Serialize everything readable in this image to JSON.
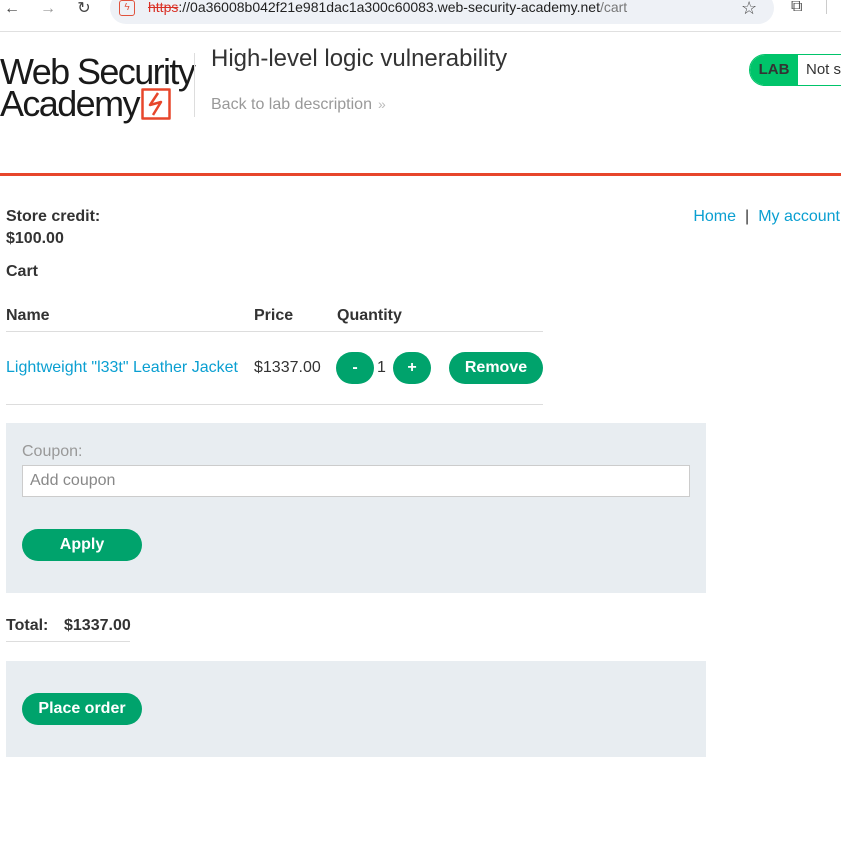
{
  "browser": {
    "url_scheme": "https",
    "url_sep": "://",
    "url_host": "0a36008b042f21e981dac1a300c60083.web-security-academy.net",
    "url_path": "/cart",
    "back_icon": "←",
    "forward_icon": "→",
    "reload_icon": "↻",
    "star_icon": "☆",
    "extensions_icon": "⧉",
    "site_icon": "ϟ"
  },
  "header": {
    "logo_line1": "Web Security",
    "logo_line2": "Academy",
    "lab_title": "High-level logic vulnerability",
    "back_link": "Back to lab description",
    "back_chevron": "»",
    "lab_badge": "LAB",
    "lab_status": "Not solved",
    "accent_color": "#e7462b",
    "badge_color": "#00c46a"
  },
  "account": {
    "store_credit_label": "Store credit:",
    "store_credit_value": "$100.00"
  },
  "nav": {
    "home": "Home",
    "separator": "|",
    "my_account": "My account"
  },
  "cart": {
    "heading": "Cart",
    "columns": [
      "Name",
      "Price",
      "Quantity"
    ],
    "items": [
      {
        "name": "Lightweight \"l33t\" Leather Jacket",
        "price": "$1337.00",
        "quantity": "1",
        "minus_label": "-",
        "plus_label": "+",
        "remove_label": "Remove"
      }
    ]
  },
  "coupon": {
    "label": "Coupon:",
    "placeholder": "Add coupon",
    "value": "",
    "apply_label": "Apply"
  },
  "total": {
    "label": "Total:",
    "value": "$1337.00"
  },
  "order": {
    "place_order_label": "Place order"
  },
  "colors": {
    "button": "#00a36c",
    "link": "#0a9fd1",
    "panel": "#e8edf1"
  }
}
